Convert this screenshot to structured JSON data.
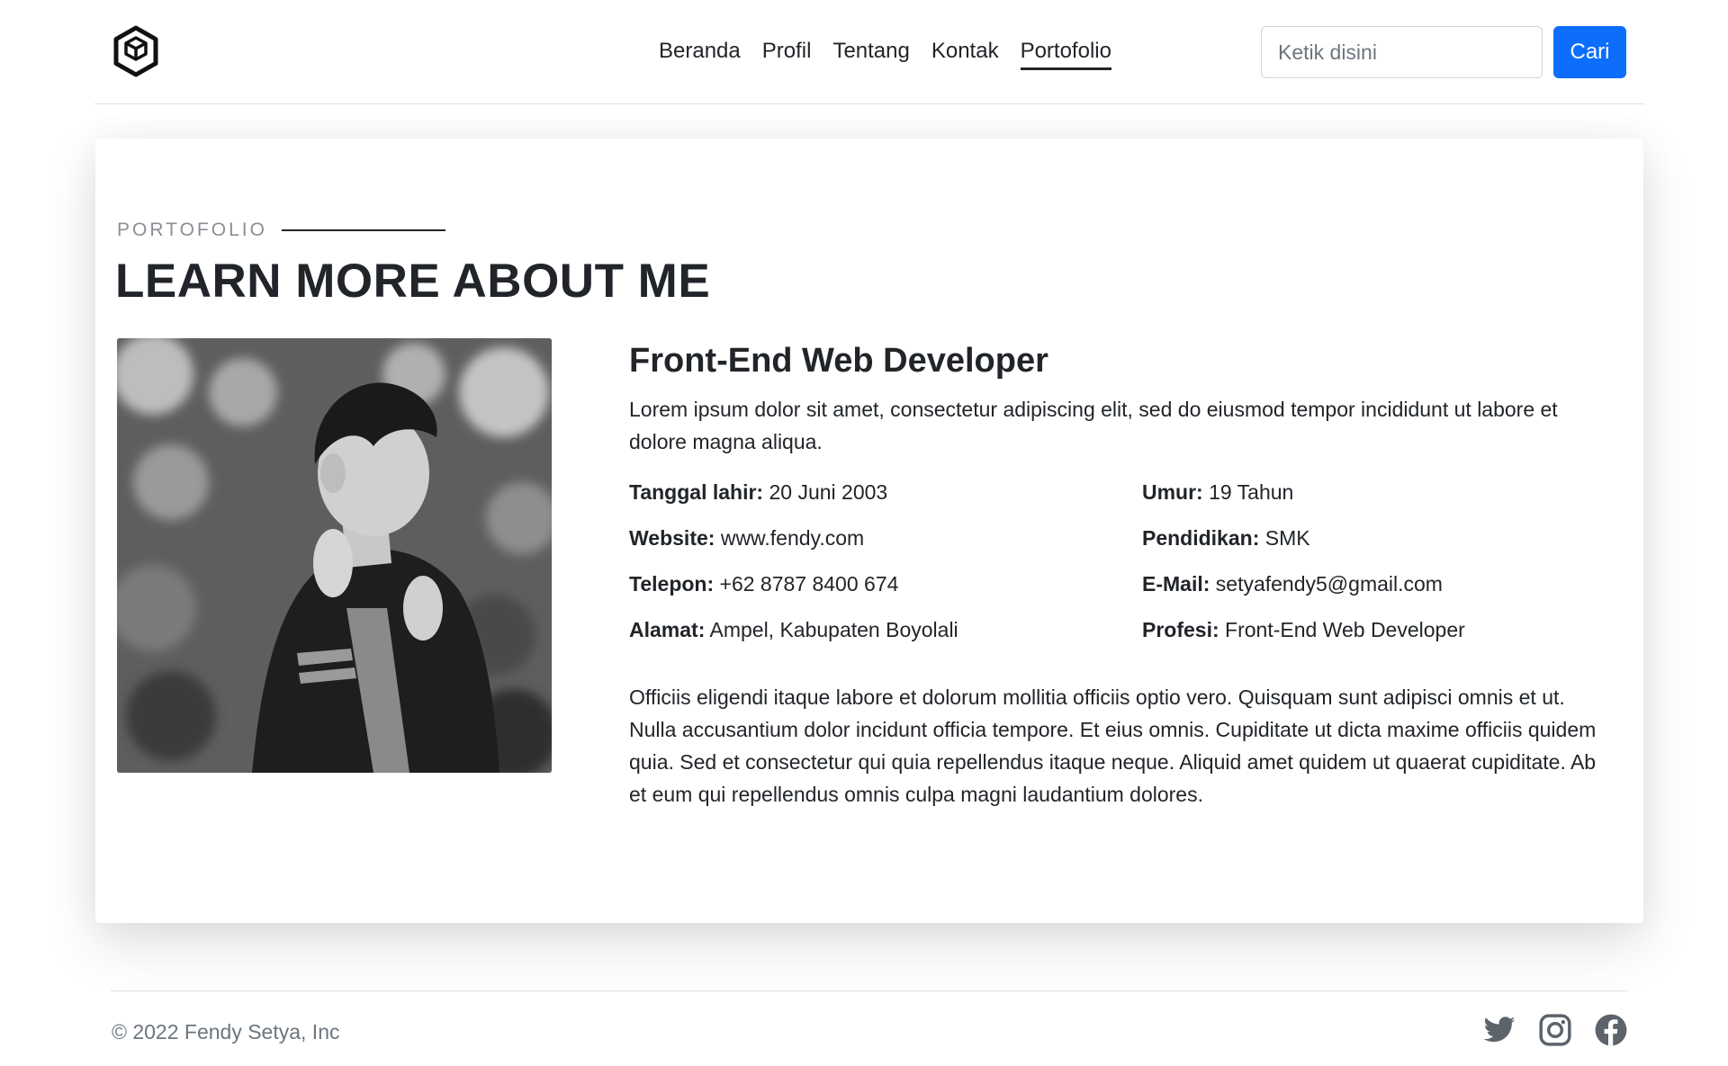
{
  "navbar": {
    "logo_icon": "hexagon-cube-logo-icon",
    "links": [
      {
        "label": "Beranda",
        "active": false
      },
      {
        "label": "Profil",
        "active": false
      },
      {
        "label": "Tentang",
        "active": false
      },
      {
        "label": "Kontak",
        "active": false
      },
      {
        "label": "Portofolio",
        "active": true
      }
    ],
    "search": {
      "placeholder": "Ketik disini",
      "value": "",
      "button_label": "Cari"
    }
  },
  "section": {
    "eyebrow": "PORTOFOLIO",
    "title": "LEARN MORE ABOUT ME",
    "photo_icon": "profile-photo",
    "role": "Front-End Web Developer",
    "intro": "Lorem ipsum dolor sit amet, consectetur adipiscing elit, sed do eiusmod tempor incididunt ut labore et dolore magna aliqua.",
    "facts": [
      {
        "label": "Tanggal lahir:",
        "value": " 20 Juni 2003"
      },
      {
        "label": "Umur:",
        "value": " 19 Tahun"
      },
      {
        "label": "Website:",
        "value": " www.fendy.com"
      },
      {
        "label": "Pendidikan:",
        "value": " SMK"
      },
      {
        "label": "Telepon:",
        "value": " +62 8787 8400 674"
      },
      {
        "label": "E-Mail:",
        "value": " setyafendy5@gmail.com"
      },
      {
        "label": "Alamat:",
        "value": " Ampel, Kabupaten Boyolali"
      },
      {
        "label": "Profesi:",
        "value": " Front-End Web Developer"
      }
    ],
    "outro": "Officiis eligendi itaque labore et dolorum mollitia officiis optio vero. Quisquam sunt adipisci omnis et ut. Nulla accusantium dolor incidunt officia tempore. Et eius omnis. Cupiditate ut dicta maxime officiis quidem quia. Sed et consectetur qui quia repellendus itaque neque. Aliquid amet quidem ut quaerat cupiditate. Ab et eum qui repellendus omnis culpa magni laudantium dolores."
  },
  "footer": {
    "copyright": "© 2022 Fendy Setya, Inc",
    "socials": [
      "twitter-icon",
      "instagram-icon",
      "facebook-icon"
    ]
  },
  "colors": {
    "primary": "#0d6efd",
    "text": "#212529",
    "muted": "#6c757d",
    "icon": "#5c636a"
  }
}
